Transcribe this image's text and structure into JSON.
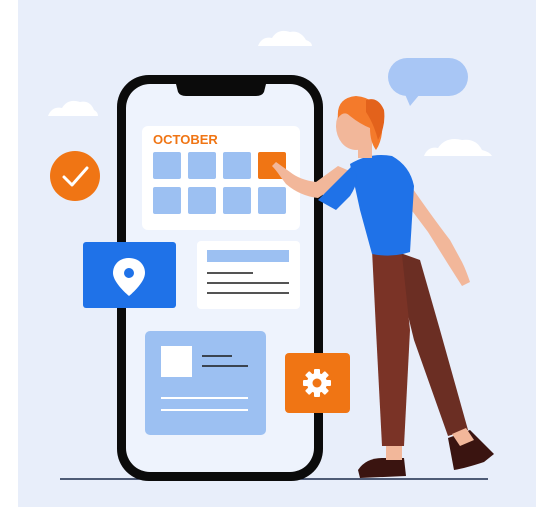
{
  "calendar": {
    "month_label": "OCTOBER"
  },
  "colors": {
    "background": "#e8eefa",
    "phone_frame": "#0b0b0b",
    "screen": "#eef3fd",
    "accent_blue": "#1f72e8",
    "accent_orange": "#f07514",
    "light_blue": "#9cc0f2",
    "cloud": "#ffffff",
    "speech_bubble": "#a8c6f5"
  },
  "icons": {
    "check": "check-icon",
    "location": "location-pin-icon",
    "settings": "gear-icon"
  }
}
